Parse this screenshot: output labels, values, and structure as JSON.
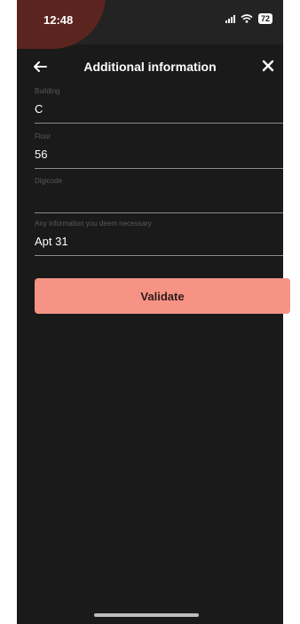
{
  "status_bar": {
    "time": "12:48",
    "battery": "72"
  },
  "header": {
    "title": "Additional information",
    "back_icon": "arrow-left-icon",
    "close_icon": "close-icon"
  },
  "fields": {
    "building": {
      "label": "Building",
      "value": "C"
    },
    "floor": {
      "label": "Floor",
      "value": "56"
    },
    "digicode": {
      "label": "Digicode",
      "value": ""
    },
    "info": {
      "label": "Any information you deem necessary",
      "value": "Apt 31"
    }
  },
  "actions": {
    "validate_label": "Validate"
  },
  "colors": {
    "background": "#1a1a1a",
    "accent": "#f79384"
  }
}
